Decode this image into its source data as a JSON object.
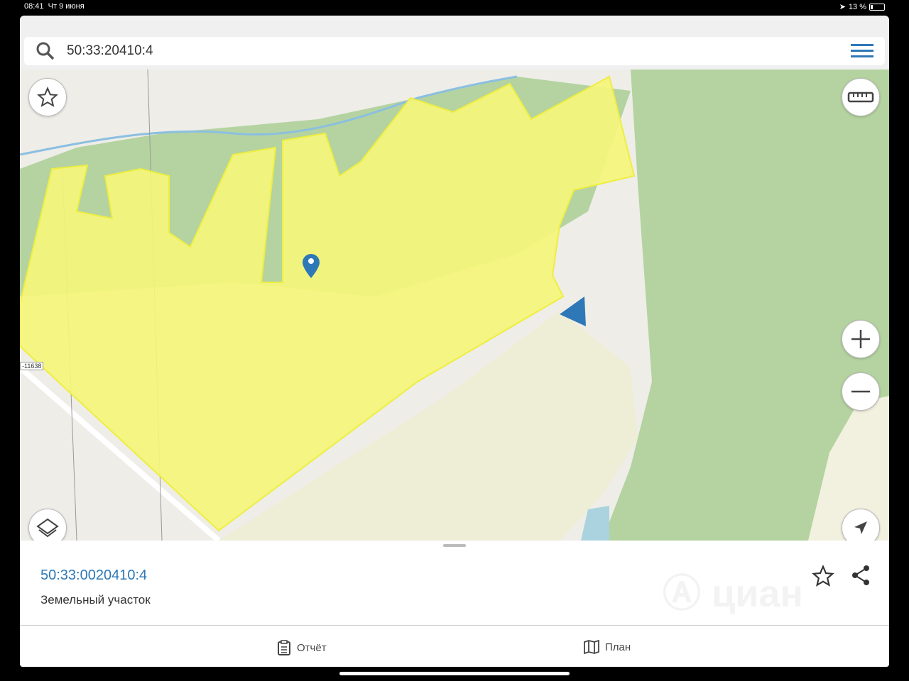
{
  "status_bar": {
    "time": "08:41",
    "date": "Чт 9 июня",
    "battery": "13 %"
  },
  "search": {
    "value": "50:33:20410:4"
  },
  "map": {
    "road_label": "-11638",
    "parcel_color": "#f5f57a",
    "forest_color": "#b4d3a0"
  },
  "sheet": {
    "cadastral_number": "50:33:0020410:4",
    "type": "Земельный участок",
    "watermark": "циан"
  },
  "tabs": [
    {
      "label": "Отчёт",
      "icon": "report-icon"
    },
    {
      "label": "План",
      "icon": "map-plan-icon"
    }
  ],
  "colors": {
    "accent": "#2e78b7"
  }
}
